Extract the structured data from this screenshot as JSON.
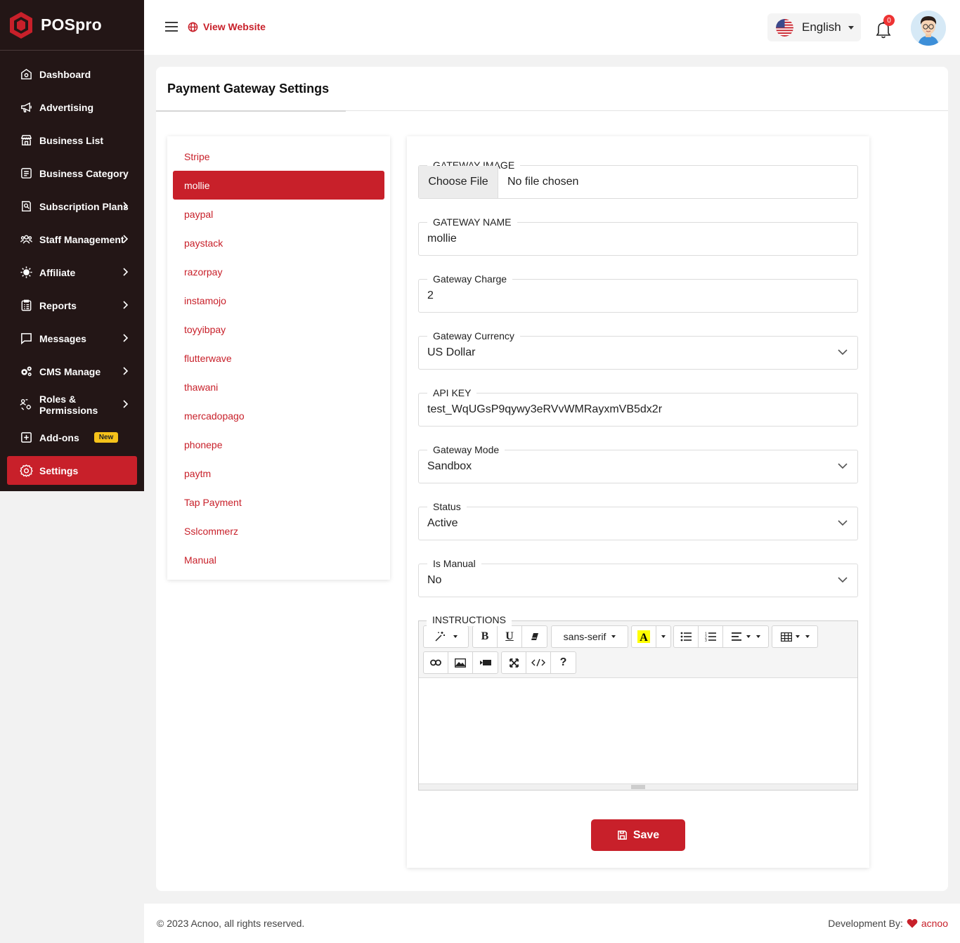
{
  "brand": {
    "name": "POSpro"
  },
  "sidebar": {
    "items": [
      {
        "label": "Dashboard",
        "icon": "home-icon",
        "has_submenu": false
      },
      {
        "label": "Advertising",
        "icon": "megaphone-icon",
        "has_submenu": false
      },
      {
        "label": "Business List",
        "icon": "store-icon",
        "has_submenu": false
      },
      {
        "label": "Business Category",
        "icon": "category-icon",
        "has_submenu": false
      },
      {
        "label": "Subscription Plans",
        "icon": "subscription-icon",
        "has_submenu": true
      },
      {
        "label": "Staff Management",
        "icon": "users-icon",
        "has_submenu": true
      },
      {
        "label": "Affiliate",
        "icon": "affiliate-icon",
        "has_submenu": true
      },
      {
        "label": "Reports",
        "icon": "reports-icon",
        "has_submenu": true
      },
      {
        "label": "Messages",
        "icon": "message-icon",
        "has_submenu": true
      },
      {
        "label": "CMS Manage",
        "icon": "cms-gears-icon",
        "has_submenu": true
      },
      {
        "label": "Roles & Permissions",
        "icon": "roles-icon",
        "has_submenu": true
      },
      {
        "label": "Add-ons",
        "icon": "addons-icon",
        "has_submenu": false,
        "badge": "New"
      },
      {
        "label": "Settings",
        "icon": "settings-gear-icon",
        "has_submenu": false,
        "active": true
      }
    ]
  },
  "header": {
    "view_website": "View Website",
    "language": "English",
    "notification_count": "0"
  },
  "page": {
    "title": "Payment Gateway Settings"
  },
  "gateways": [
    "Stripe",
    "mollie",
    "paypal",
    "paystack",
    "razorpay",
    "instamojo",
    "toyyibpay",
    "flutterwave",
    "thawani",
    "mercadopago",
    "phonepe",
    "paytm",
    "Tap Payment",
    "Sslcommerz",
    "Manual"
  ],
  "active_gateway": "mollie",
  "form": {
    "gateway_image": {
      "label": "GATEWAY IMAGE",
      "button": "Choose File",
      "status": "No file chosen"
    },
    "gateway_name": {
      "label": "GATEWAY NAME",
      "value": "mollie"
    },
    "gateway_charge": {
      "label": "Gateway Charge",
      "value": "2"
    },
    "gateway_currency": {
      "label": "Gateway Currency",
      "value": "US Dollar"
    },
    "api_key": {
      "label": "API KEY",
      "value": "test_WqUGsP9qywy3eRVvWMRayxmVB5dx2r"
    },
    "gateway_mode": {
      "label": "Gateway Mode",
      "value": "Sandbox"
    },
    "status": {
      "label": "Status",
      "value": "Active"
    },
    "is_manual": {
      "label": "Is Manual",
      "value": "No"
    },
    "instructions": {
      "label": "INSTRUCTIONS",
      "font": "sans-serif",
      "content": ""
    },
    "save": "Save"
  },
  "footer": {
    "copyright": "© 2023 Acnoo, all rights reserved.",
    "dev_by": "Development By:",
    "dev_link": "acnoo"
  },
  "colors": {
    "accent": "#c8202a",
    "sidebar_bg": "#231616",
    "page_bg": "#f2f2f2"
  }
}
